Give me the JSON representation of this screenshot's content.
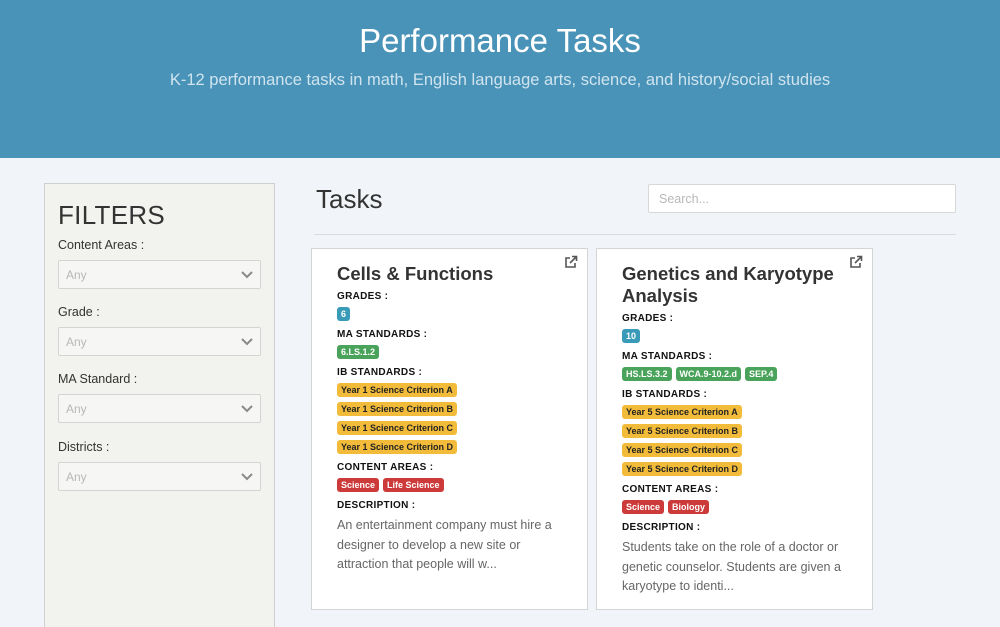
{
  "header": {
    "title": "Performance Tasks",
    "subtitle": "K-12 performance tasks in math, English language arts, science, and history/social studies"
  },
  "filters": {
    "title": "FILTERS",
    "items": [
      {
        "label": "Content Areas :",
        "value": "Any"
      },
      {
        "label": "Grade :",
        "value": "Any"
      },
      {
        "label": "MA Standard :",
        "value": "Any"
      },
      {
        "label": "Districts :",
        "value": "Any"
      }
    ]
  },
  "tasks": {
    "title": "Tasks",
    "search_placeholder": "Search..."
  },
  "section_labels": {
    "grades": "GRADES :",
    "ma": "MA STANDARDS :",
    "ib": "IB STANDARDS :",
    "areas": "CONTENT AREAS :",
    "desc": "DESCRIPTION :"
  },
  "cards": [
    {
      "title": "Cells & Functions",
      "grades": [
        "6"
      ],
      "ma_standards": [
        "6.LS.1.2"
      ],
      "ib_standards": [
        "Year 1 Science Criterion A",
        "Year 1 Science Criterion B",
        "Year 1 Science Criterion C",
        "Year 1 Science Criterion D"
      ],
      "content_areas": [
        "Science",
        "Life Science"
      ],
      "description": "An entertainment company must hire a designer to develop a new site or attraction that people will w..."
    },
    {
      "title": "Genetics and Karyotype Analysis",
      "grades": [
        "10"
      ],
      "ma_standards": [
        "HS.LS.3.2",
        "WCA.9-10.2.d",
        "SEP.4"
      ],
      "ib_standards": [
        "Year 5 Science Criterion A",
        "Year 5 Science Criterion B",
        "Year 5 Science Criterion C",
        "Year 5 Science Criterion D"
      ],
      "content_areas": [
        "Science",
        "Biology"
      ],
      "description": "Students take on the role of a doctor or genetic counselor. Students are given a karyotype to identi..."
    }
  ],
  "colors": {
    "header_bg": "#4993b8",
    "grade_tag": "#3a9bb8",
    "ma_tag": "#4aa35a",
    "ib_tag": "#f2bc3a",
    "area_tag": "#cc3a3a"
  },
  "icons": {
    "filter_select": "chevron-down-icon",
    "card_link": "external-link-icon"
  }
}
